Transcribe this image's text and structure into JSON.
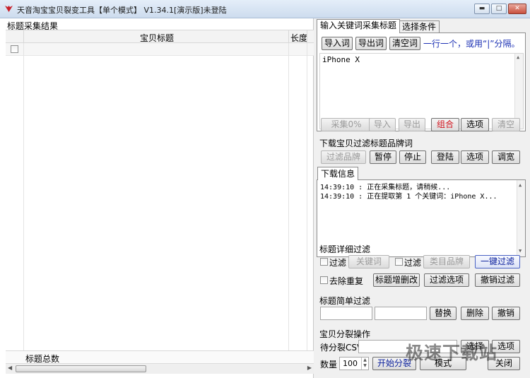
{
  "window": {
    "title": "天音淘宝宝贝裂变工具【单个模式】 V1.34.1[演示版]未登陆",
    "controls": {
      "minimize": "▬",
      "maximize": "□",
      "close": "✕"
    }
  },
  "left_panel": {
    "caption": "标题采集结果",
    "columns": [
      "宝贝标题",
      "长度"
    ],
    "footer_label": "标题总数"
  },
  "right_panel": {
    "tabs": [
      "输入关键词采集标题",
      "选择条件"
    ],
    "keyword_tab": {
      "buttons": [
        "导入词",
        "导出词",
        "清空词"
      ],
      "hint": "一行一个，或用“|”分隔。",
      "keywords_text": "iPhone X"
    },
    "collect_buttons": {
      "collect": "采集0%",
      "import": "导入",
      "export": "导出",
      "combine": "组合",
      "options": "选项",
      "clear": "清空"
    },
    "brand_filter": {
      "label": "下载宝贝过滤标题品牌词",
      "filter_brand": "过滤品牌",
      "pause": "暂停",
      "stop": "停止",
      "login": "登陆",
      "options": "选项",
      "adjust": "调宽"
    },
    "download_info": {
      "tab": "下载信息",
      "logs": [
        "14:39:10 : 正在采集标题，请稍候...",
        "14:39:10 : 正在提取第 1 个关键词：iPhone X..."
      ]
    },
    "detail_filter": {
      "label": "标题详细过滤",
      "filter1": "过滤",
      "keyword_btn": "关键词",
      "filter2": "过滤",
      "category_btn": "类目品牌",
      "one_click": "一键过滤",
      "dedupe": "去除重复",
      "edit_titles": "标题增删改",
      "filter_options": "过滤选项",
      "undo_filter": "撤销过滤"
    },
    "simple_filter": {
      "label": "标题简单过滤",
      "replace": "替换",
      "delete": "删除",
      "undo": "撤销"
    },
    "split": {
      "label": "宝贝分裂操作",
      "csv_label": "待分裂CSV",
      "choose": "选择",
      "options": "选项",
      "qty_label": "数量",
      "qty_value": "100",
      "start": "开始分裂",
      "mode": "模式",
      "extra": "关闭"
    }
  },
  "watermark": "极速下载站",
  "colors": {
    "accent_red": "#d2141e",
    "hint_blue": "#1a2fb3"
  }
}
